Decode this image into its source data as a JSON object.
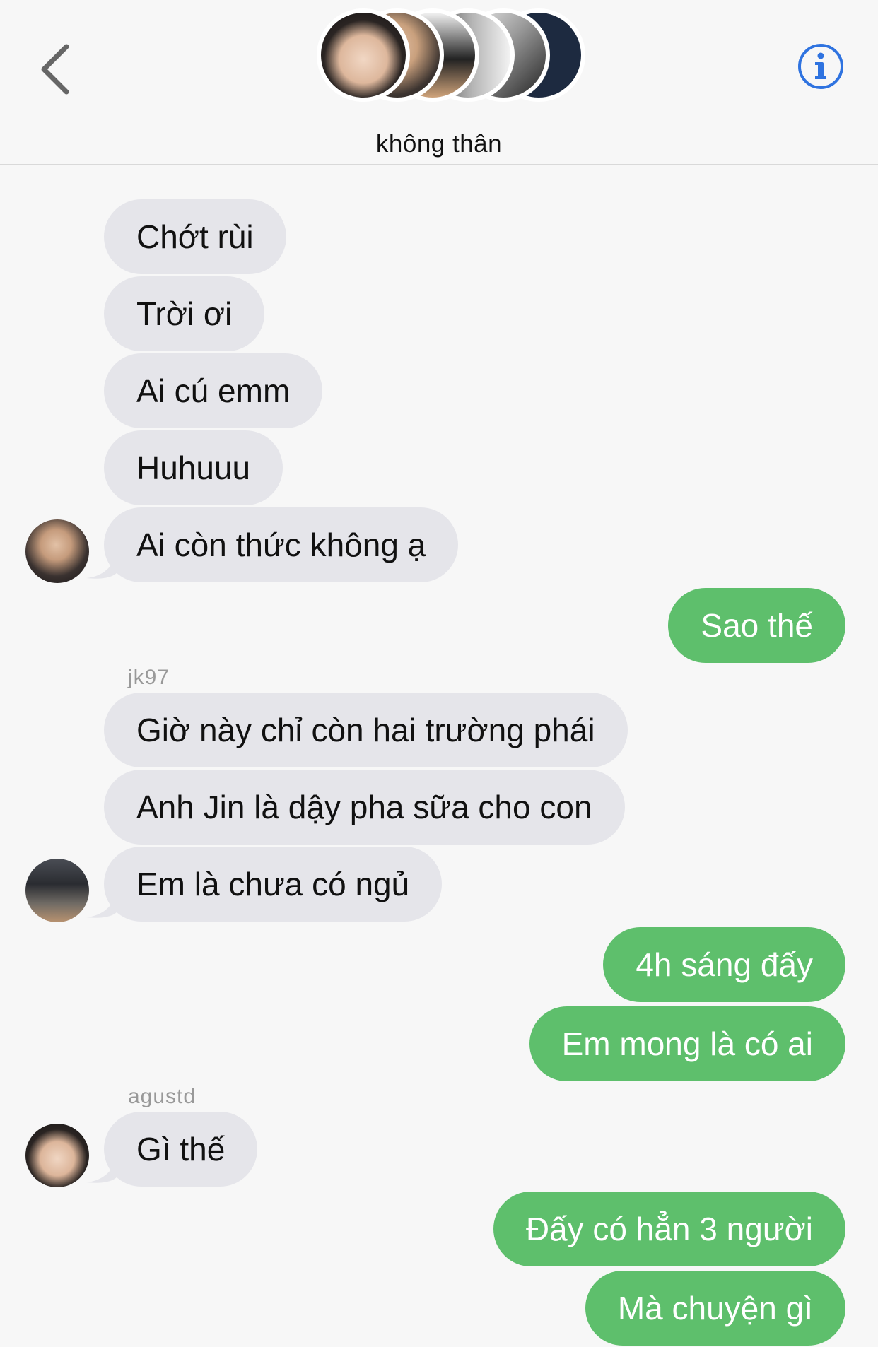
{
  "header": {
    "group_title": "không thân",
    "back_icon": "chevron-left-icon",
    "info_icon": "info-icon",
    "accent_color": "#2f73e0"
  },
  "messages": [
    {
      "dir": "in",
      "text": "Chớt rùi"
    },
    {
      "dir": "in",
      "text": "Trời ơi"
    },
    {
      "dir": "in",
      "text": "Ai cú emm"
    },
    {
      "dir": "in",
      "text": "Huhuuu"
    },
    {
      "dir": "in",
      "text": "Ai còn thức không ạ"
    },
    {
      "dir": "out",
      "text": "Sao thế"
    },
    {
      "dir": "in",
      "sender": "jk97",
      "text": "Giờ này chỉ còn hai trường phái"
    },
    {
      "dir": "in",
      "text": "Anh Jin là dậy pha sữa cho con"
    },
    {
      "dir": "in",
      "text": "Em là chưa có ngủ"
    },
    {
      "dir": "out",
      "text": "4h sáng đấy"
    },
    {
      "dir": "out",
      "text": "Em mong là có ai"
    },
    {
      "dir": "in",
      "sender": "agustd",
      "text": "Gì thế"
    },
    {
      "dir": "out",
      "text": "Đấy có hẳn 3 người"
    },
    {
      "dir": "out",
      "text": "Mà chuyện gì"
    }
  ],
  "colors": {
    "incoming_bubble": "#e5e5ea",
    "outgoing_bubble": "#5ebf6c",
    "background": "#f7f7f7"
  }
}
